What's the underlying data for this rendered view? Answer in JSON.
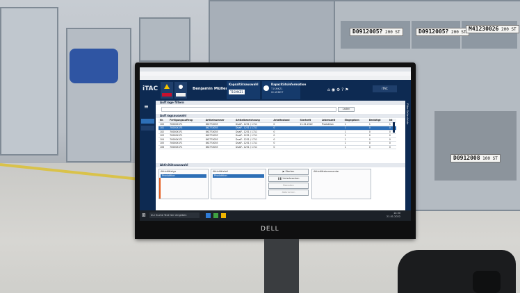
{
  "bin_labels": [
    {
      "code": "D0912005?",
      "qty": "200 ST"
    },
    {
      "code": "D0912005?",
      "qty": "200 ST"
    },
    {
      "code": "M41230026",
      "qty": "200 ST"
    },
    {
      "code": "D0912008",
      "qty": "100 ST"
    }
  ],
  "app": {
    "logo": "iTAC",
    "user_name": "Benjamin Müller",
    "header_panel_title": "Kapazitätsauswahl",
    "header_panel_value": "T1SMKZ1",
    "info_panel_title": "Kapazitätsinformation",
    "info_panel_value1": "T1SMKZ1",
    "info_panel_value2": "IN ARBEIT",
    "tab_title": "Auftrage filtern",
    "search_button": "Laden",
    "orders_section": "Auftragsauswahl",
    "columns": [
      "Nr.",
      "Fertigungsauftrag",
      "Artikelnummer",
      "Artikelbezeichnung",
      "Arbeitsstand",
      "Startzeit",
      "Lebenszeit",
      "Eingegeben",
      "Bestätigt",
      "Ist"
    ],
    "rows": [
      [
        "100",
        "70000X1F1",
        "8IG77X03E",
        "DualF.. 1231 / 1711",
        "0",
        "21.01.2022",
        "Produktion",
        "1",
        "1",
        "1"
      ],
      [
        "101",
        "70000X1F5",
        "8IG77X03E",
        "DualF.. 1231 / 1711",
        "0",
        "",
        "",
        "1",
        "0",
        "0"
      ],
      [
        "102",
        "70000X1F1",
        "8IG77X03E",
        "DualF.. 1231 / 1711",
        "0",
        "",
        "",
        "1",
        "0",
        "0"
      ],
      [
        "103",
        "70000X1F1",
        "8IG77X03E",
        "DualF.. 1231 / 1711",
        "0",
        "",
        "",
        "1",
        "0",
        "0"
      ],
      [
        "104",
        "70000X1F1",
        "8IG77X03E",
        "DualF.. 1231 / 1711",
        "0",
        "",
        "",
        "1",
        "0",
        "0"
      ],
      [
        "105",
        "70000X1F1",
        "8IG77X03E",
        "DualF.. 1231 / 1711",
        "0",
        "",
        "",
        "1",
        "0",
        "0"
      ],
      [
        "106",
        "70000X1F1",
        "8IG77X03E",
        "DualF.. 1231 / 1711",
        "0",
        "",
        "",
        "1",
        "0",
        "0"
      ]
    ],
    "selected_row": 1,
    "activity_section": "Aktivitätsauswahl",
    "panel_left_title": "Aktivitätstyp",
    "panel_left_value": "Produktion",
    "panel_mid_title": "Aktivitätsfall",
    "panel_mid_value": "Produktion",
    "actions": [
      "Starten",
      "Unterbrechen",
      "Beenden",
      "Abbrechen"
    ],
    "panel_right_title": "Aktivitätskommentar",
    "side_tab": "Filter-Seitenleiste",
    "taskbar_search": "Zur Suche Text hier eingeben",
    "clock_time": "14:30",
    "clock_date": "21.01.2022"
  },
  "monitor_brand": "DELL"
}
